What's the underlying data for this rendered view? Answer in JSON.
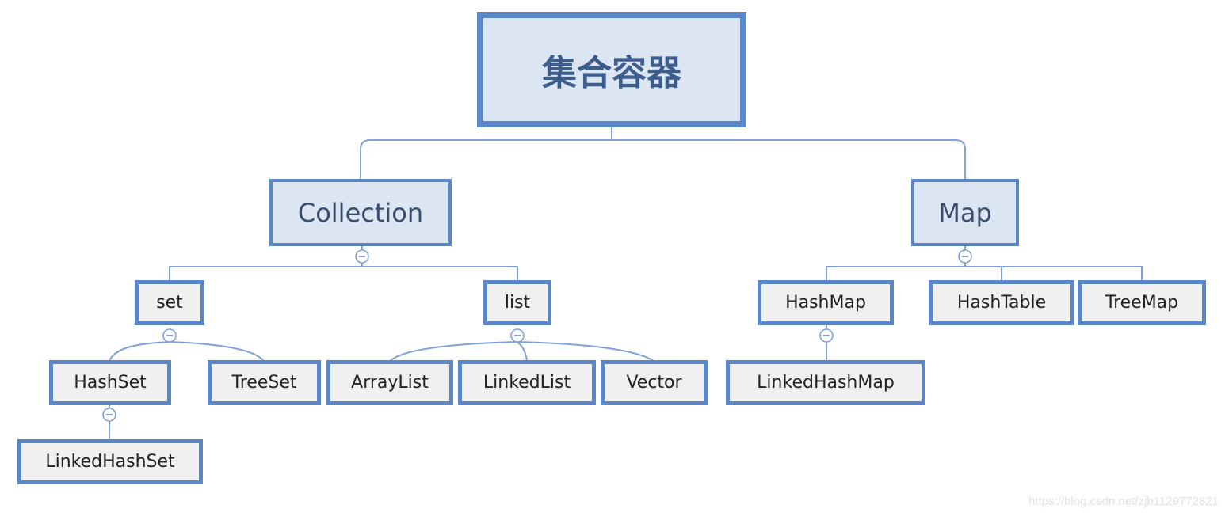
{
  "diagram": {
    "type": "tree",
    "root": {
      "label": "集合容器",
      "children": [
        {
          "label": "Collection",
          "collapsible": true,
          "children": [
            {
              "label": "set",
              "collapsible": true,
              "children": [
                {
                  "label": "HashSet",
                  "collapsible": true,
                  "children": [
                    {
                      "label": "LinkedHashSet"
                    }
                  ]
                },
                {
                  "label": "TreeSet"
                }
              ]
            },
            {
              "label": "list",
              "collapsible": true,
              "children": [
                {
                  "label": "ArrayList"
                },
                {
                  "label": "LinkedList"
                },
                {
                  "label": "Vector"
                }
              ]
            }
          ]
        },
        {
          "label": "Map",
          "collapsible": true,
          "children": [
            {
              "label": "HashMap",
              "collapsible": true,
              "children": [
                {
                  "label": "LinkedHashMap"
                }
              ]
            },
            {
              "label": "HashTable"
            },
            {
              "label": "TreeMap"
            }
          ]
        }
      ]
    }
  },
  "nodes": {
    "root": "集合容器",
    "collection": "Collection",
    "map": "Map",
    "set": "set",
    "list": "list",
    "hashset": "HashSet",
    "treeset": "TreeSet",
    "linkedhashset": "LinkedHashSet",
    "arraylist": "ArrayList",
    "linkedlist": "LinkedList",
    "vector": "Vector",
    "hashmap": "HashMap",
    "hashtable": "HashTable",
    "treemap": "TreeMap",
    "linkedhashmap": "LinkedHashMap"
  },
  "collapse_icon": "minus-circle-icon",
  "colors": {
    "border": "#5b87c8",
    "upper_fill": "#dce6f2",
    "leaf_fill": "#f0f0f0",
    "connector": "#7fa2d6",
    "root_text": "#3d5e8c"
  },
  "watermark": "https://blog.csdn.net/zjb1129772821"
}
